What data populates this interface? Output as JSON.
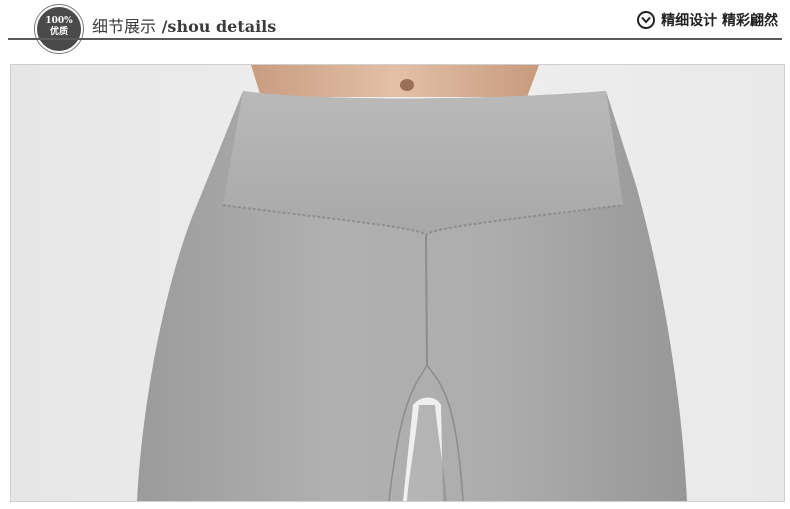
{
  "header": {
    "badge_line1": "100%",
    "badge_line2": "优质",
    "title_zh": "细节展示",
    "title_en": " /shou details",
    "tagline": "精细设计 精彩翩然",
    "tagline_icon": "chevron-down-circle-icon"
  },
  "photo": {
    "subject": "gray-leggings-waistband-closeup"
  },
  "colors": {
    "fabric": "#a9a9a9",
    "background": "#ececec",
    "skin": "#d9b59c",
    "rule": "#5a5a5a"
  }
}
